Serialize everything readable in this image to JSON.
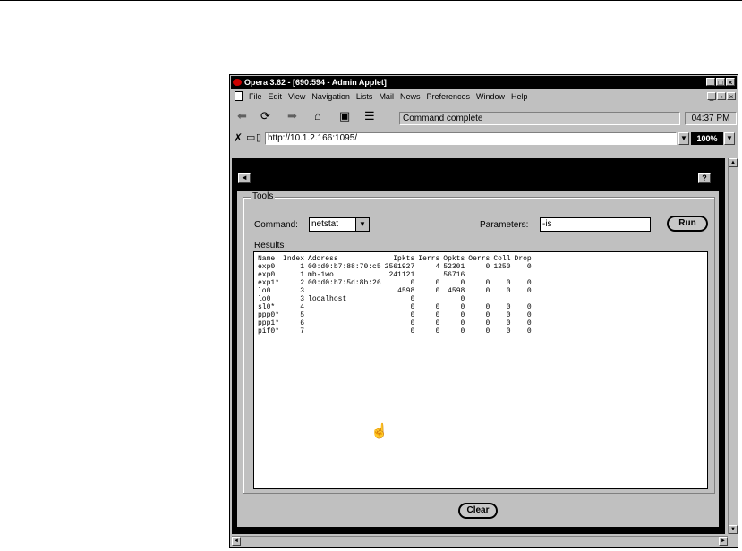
{
  "window": {
    "title": "Opera 3.62 - [690:594 - Admin Applet]",
    "controls": [
      "_",
      "□",
      "×"
    ]
  },
  "menubar": {
    "items": [
      "File",
      "Edit",
      "View",
      "Navigation",
      "Lists",
      "Mail",
      "News",
      "Preferences",
      "Window",
      "Help"
    ],
    "doc_controls": [
      "_",
      "▫",
      "×"
    ]
  },
  "toolbar": {
    "status": "Command complete",
    "clock": "04:37 PM"
  },
  "addressbar": {
    "url": "http://10.1.2.166:1095/",
    "zoom": "100%"
  },
  "content": {
    "back": "◄",
    "help": "?"
  },
  "tools": {
    "group_label": "Tools",
    "command_label": "Command:",
    "command_value": "netstat",
    "parameters_label": "Parameters:",
    "parameters_value": "-is",
    "run_label": "Run",
    "results_label": "Results",
    "clear_label": "Clear"
  },
  "results": {
    "columns": [
      "Name",
      "Index",
      "Address",
      "Ipkts",
      "Ierrs",
      "Opkts",
      "Oerrs",
      "Coll",
      "Drop"
    ],
    "rows": [
      [
        "exp0",
        "1",
        "00:d0:b7:88:70:c5",
        "2561927",
        "4",
        "52301",
        "0",
        "1250",
        "0"
      ],
      [
        "exp0",
        "1",
        "mb-1wo",
        "241121",
        "",
        "56716",
        "",
        "",
        ""
      ],
      [
        "exp1*",
        "2",
        "00:d0:b7:5d:8b:26",
        "0",
        "0",
        "0",
        "0",
        "0",
        "0"
      ],
      [
        "lo0",
        "3",
        "",
        "4598",
        "0",
        "4598",
        "0",
        "0",
        "0"
      ],
      [
        "lo0",
        "3",
        "localhost",
        "0",
        "",
        "0",
        "",
        "",
        ""
      ],
      [
        "sl0*",
        "4",
        "",
        "0",
        "0",
        "0",
        "0",
        "0",
        "0"
      ],
      [
        "ppp0*",
        "5",
        "",
        "0",
        "0",
        "0",
        "0",
        "0",
        "0"
      ],
      [
        "ppp1*",
        "6",
        "",
        "0",
        "0",
        "0",
        "0",
        "0",
        "0"
      ],
      [
        "pif0*",
        "7",
        "",
        "0",
        "0",
        "0",
        "0",
        "0",
        "0"
      ]
    ]
  }
}
